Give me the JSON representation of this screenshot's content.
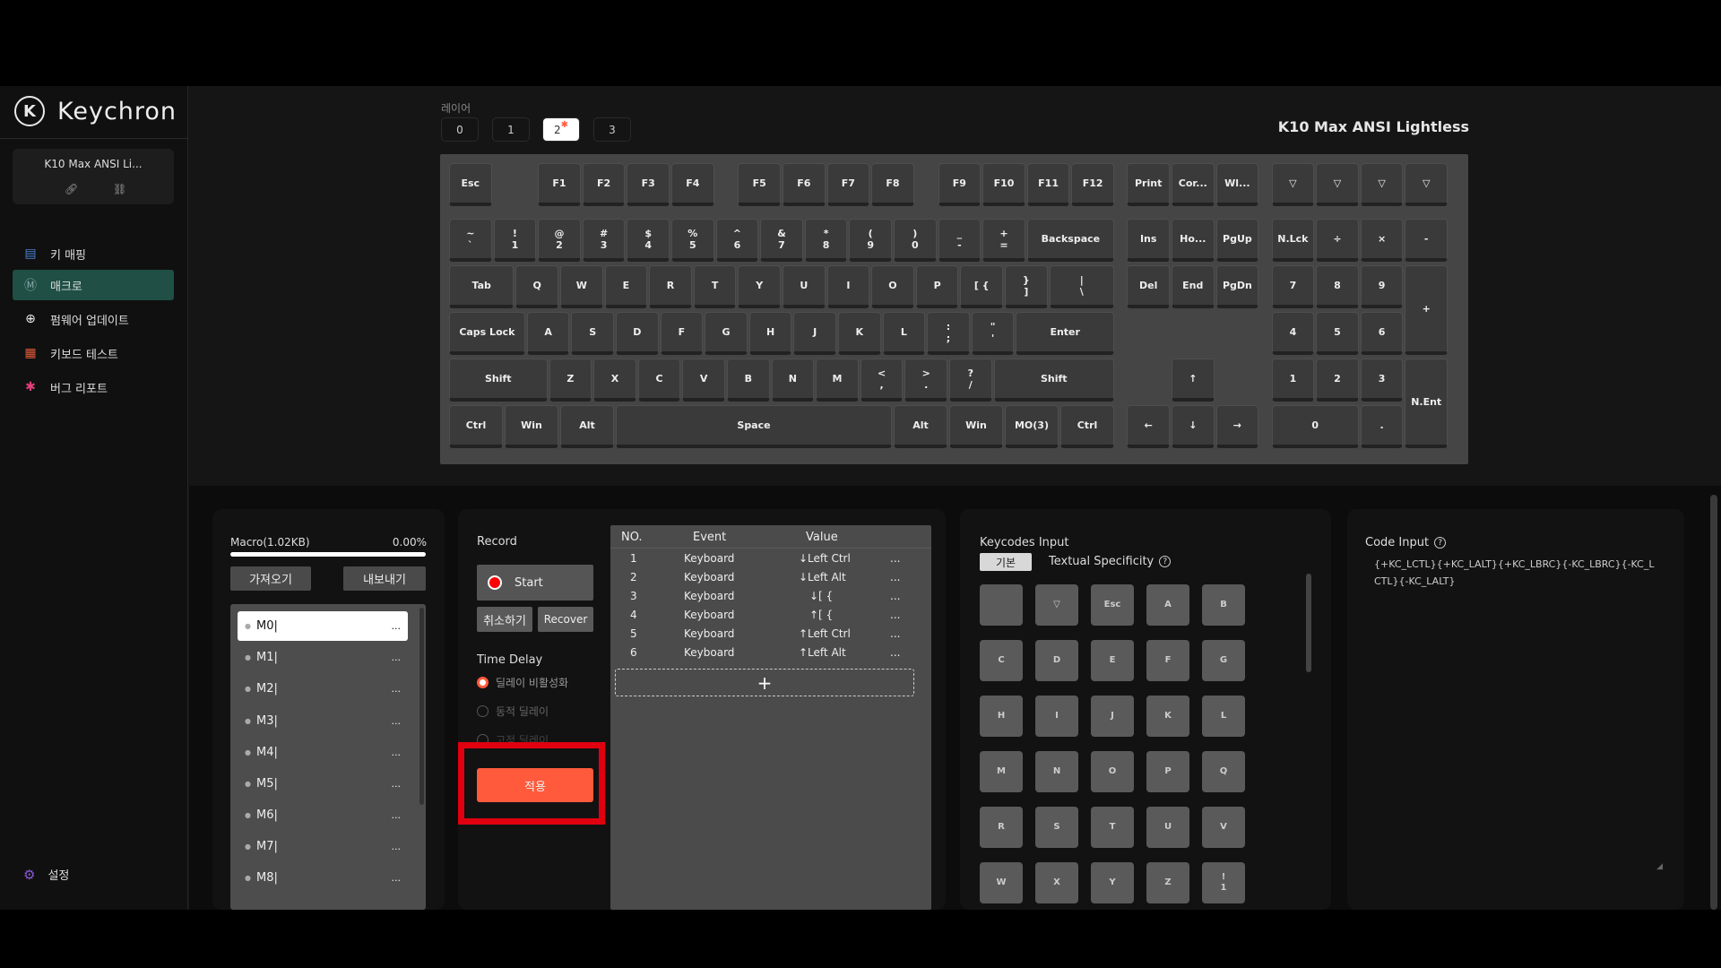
{
  "app": {
    "name": "Keychron"
  },
  "device": {
    "name": "K10 Max ANSI Li..."
  },
  "nav": [
    {
      "label": "키 매핑",
      "icon": "keymap-icon"
    },
    {
      "label": "매크로",
      "icon": "macro-icon"
    },
    {
      "label": "펌웨어 업데이트",
      "icon": "firmware-icon"
    },
    {
      "label": "키보드 테스트",
      "icon": "test-icon"
    },
    {
      "label": "버그 리포트",
      "icon": "bug-icon"
    }
  ],
  "settings": {
    "label": "설정"
  },
  "layers": {
    "label": "레이어",
    "items": [
      "0",
      "1",
      "2",
      "3"
    ],
    "selected": "2"
  },
  "keyboard_title": "K10 Max ANSI Lightless",
  "keys": [
    "Esc",
    "F1",
    "F2",
    "F3",
    "F4",
    "F5",
    "F6",
    "F7",
    "F8",
    "F9",
    "F10",
    "F11",
    "F12",
    "Print",
    "Cor...",
    "Wl...",
    "▽",
    "▽",
    "▽",
    "▽",
    "~\n`",
    "!\n1",
    "@\n2",
    "#\n3",
    "$\n4",
    "%\n5",
    "^\n6",
    "&\n7",
    "*\n8",
    "(\n9",
    ")\n0",
    "_\n-",
    "+\n=",
    "Backspace",
    "Ins",
    "Ho...",
    "PgUp",
    "N.Lck",
    "÷",
    "×",
    "-",
    "Tab",
    "Q",
    "W",
    "E",
    "R",
    "T",
    "Y",
    "U",
    "I",
    "O",
    "P",
    "[ {",
    "}\n]",
    "|\n\\",
    "Del",
    "End",
    "PgDn",
    "7",
    "8",
    "9",
    "+",
    "Caps Lock",
    "A",
    "S",
    "D",
    "F",
    "G",
    "H",
    "J",
    "K",
    "L",
    ":\n;",
    "\"\n'",
    "Enter",
    "4",
    "5",
    "6",
    "Shift",
    "Z",
    "X",
    "C",
    "V",
    "B",
    "N",
    "M",
    "<\n,",
    ">\n.",
    "?\n/",
    "Shift",
    "↑",
    "1",
    "2",
    "3",
    "N.Ent",
    "Ctrl",
    "Win",
    "Alt",
    "Space",
    "Alt",
    "Win",
    "MO(3)",
    "Ctrl",
    "←",
    "↓",
    "→",
    "0",
    "."
  ],
  "macro": {
    "title": "Macro(1.02KB)",
    "usage": "0.00%",
    "import_label": "가져오기",
    "export_label": "내보내기",
    "items": [
      "M0|",
      "M1|",
      "M2|",
      "M3|",
      "M4|",
      "M5|",
      "M6|",
      "M7|",
      "M8|"
    ],
    "more": "..."
  },
  "record": {
    "title": "Record",
    "start": "Start",
    "cancel": "취소하기",
    "recover": "Recover",
    "time_delay": "Time Delay",
    "delay_options": [
      "딜레이 비활성화",
      "동적 딜레이",
      "고정 딜레이"
    ],
    "apply": "적용"
  },
  "events": {
    "headers": [
      "NO.",
      "Event",
      "Value"
    ],
    "rows": [
      {
        "no": "1",
        "event": "Keyboard",
        "value": "↓Left Ctrl"
      },
      {
        "no": "2",
        "event": "Keyboard",
        "value": "↓Left Alt"
      },
      {
        "no": "3",
        "event": "Keyboard",
        "value": "↓[ {"
      },
      {
        "no": "4",
        "event": "Keyboard",
        "value": "↑[ {"
      },
      {
        "no": "5",
        "event": "Keyboard",
        "value": "↑Left Ctrl"
      },
      {
        "no": "6",
        "event": "Keyboard",
        "value": "↑Left Alt"
      }
    ],
    "more": "...",
    "add": "+"
  },
  "keycodes": {
    "title": "Keycodes Input",
    "tabs": [
      "기본",
      "Textual Specificity"
    ],
    "keys": [
      "",
      "▽",
      "Esc",
      "A",
      "B",
      "C",
      "D",
      "E",
      "F",
      "G",
      "H",
      "I",
      "J",
      "K",
      "L",
      "M",
      "N",
      "O",
      "P",
      "Q",
      "R",
      "S",
      "T",
      "U",
      "V",
      "W",
      "X",
      "Y",
      "Z",
      "!\n1"
    ]
  },
  "code_input": {
    "title": "Code Input",
    "value": "{+KC_LCTL}{+KC_LALT}{+KC_LBRC}{-KC_LBRC}{-KC_LCTL}{-KC_LALT}"
  },
  "colors": {
    "accent": "#ff5a3c",
    "nav_active": "#1f4f45",
    "highlight_box": "#e0000f"
  }
}
